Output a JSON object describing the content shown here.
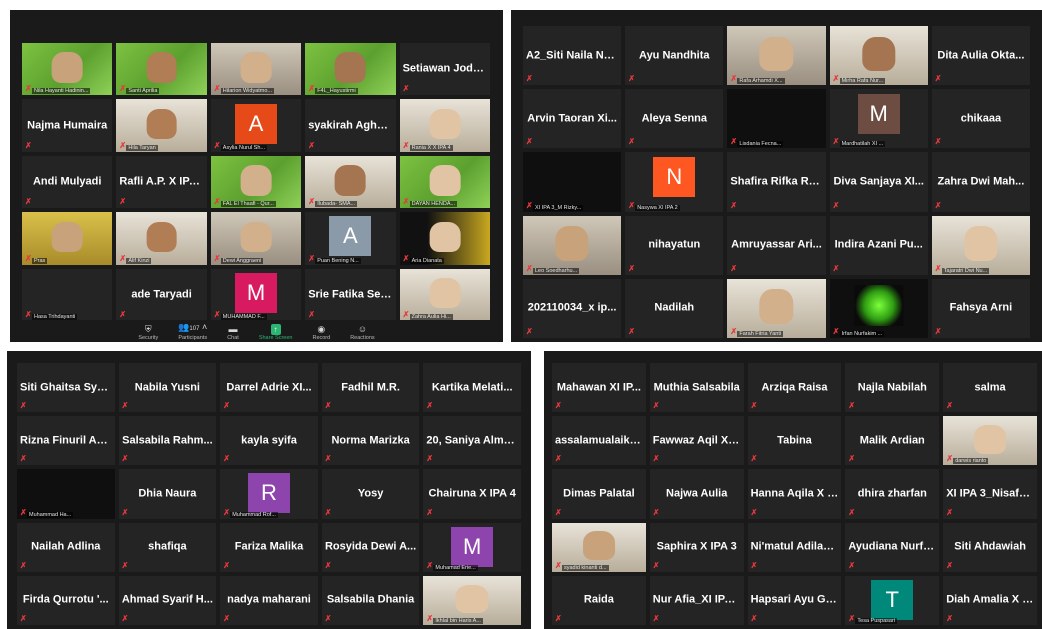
{
  "colors": {
    "mic_muted": "#e8383d",
    "active_speaker": "#c9d94a",
    "share_green": "#2bb673",
    "background": "#1a1a1a",
    "tile": "#242424"
  },
  "panel1": {
    "tiles": [
      {
        "small": "Nila Hayanti Hadinin..."
      },
      {
        "small": "Santi Aprilia"
      },
      {
        "small": "Hilarion Widyatmo..."
      },
      {
        "small": "F4L_Hayustirmi"
      },
      {
        "name": "Setiawan Jody p"
      },
      {
        "name": "Najma Humaira"
      },
      {
        "small": "Hila Taryan"
      },
      {
        "avatar": "A",
        "small": "Asylia Nurul Sh..."
      },
      {
        "name": "syakirah Aghniy..."
      },
      {
        "small": "Rania X X IPA 4"
      },
      {
        "name": "Andi Mulyadi"
      },
      {
        "name": "Rafli A.P. X IPA 4"
      },
      {
        "small": "FAL El Thaafi - Qur..."
      },
      {
        "small": "Ilubada- SMA..."
      },
      {
        "small": "DAYAN HENDA..."
      },
      {
        "small": "Pras"
      },
      {
        "small": "Alif Kinzi"
      },
      {
        "small": "Dewi Anggraeni"
      },
      {
        "avatar": "A",
        "small": "Puan Bening N..."
      },
      {
        "small": "Aria Dianata"
      },
      {
        "small": "Hasa Trihdayanti"
      },
      {
        "name": "ade Taryadi"
      },
      {
        "avatar": "M",
        "small": "MUHAMMAD F..."
      },
      {
        "name": "Srie Fatika Sety..."
      },
      {
        "small": "Zahra Aulia Hi..."
      }
    ],
    "toolbar": {
      "security": "Security",
      "participants": "Participants",
      "participants_count": "107",
      "chat": "Chat",
      "share": "Share Screen",
      "record": "Record",
      "reactions": "Reactions"
    }
  },
  "panel2": {
    "tiles": [
      {
        "name": "A2_Siti Naila Na..."
      },
      {
        "name": "Ayu Nandhita"
      },
      {
        "small": "Rafa Arhamdi X..."
      },
      {
        "small": "Mirha Rafa Nur..."
      },
      {
        "name": "Dita Aulia Okta..."
      },
      {
        "name": "Arvin Taoran Xi..."
      },
      {
        "name": "Aleya Senna"
      },
      {
        "small": "Lisdania Fecna..."
      },
      {
        "avatar": "M",
        "small": "Mardhatilah XI ..."
      },
      {
        "name": "chikaaa"
      },
      {
        "small": "XI IPA 3_M Rizky..."
      },
      {
        "avatar": "N",
        "small": "Nasywa XI IPA 2"
      },
      {
        "name": "Shafira Rifka Ra..."
      },
      {
        "name": "Diva Sanjaya XI..."
      },
      {
        "name": "Zahra Dwi Mah..."
      },
      {
        "small": "Leo Soedharhu..."
      },
      {
        "name": "nihayatun"
      },
      {
        "name": "Amruyassar Ari..."
      },
      {
        "name": "Indira Azani Pu..."
      },
      {
        "small": "Tajaratri Dwi Nu..."
      },
      {
        "name": "202110034_x ip..."
      },
      {
        "name": "Nadilah"
      },
      {
        "small": "Farah Fitria Yanti"
      },
      {
        "small": "Irfan Nurfakim ..."
      },
      {
        "name": "Fahsya Arni"
      }
    ]
  },
  "panel3": {
    "tiles": [
      {
        "name": "Siti Ghaitsa Sya..."
      },
      {
        "name": "Nabila Yusni"
      },
      {
        "name": "Darrel Adrie XI..."
      },
      {
        "name": "Fadhil M.R."
      },
      {
        "name": "Kartika Melati..."
      },
      {
        "name": "Rizna Finuril Au..."
      },
      {
        "name": "Salsabila Rahm..."
      },
      {
        "name": "kayla syifa"
      },
      {
        "name": "Norma Marizka"
      },
      {
        "name": "20, Saniya Alma..."
      },
      {
        "small": "Muhammad Ha..."
      },
      {
        "name": "Dhia Naura"
      },
      {
        "avatar": "R",
        "small": "Muhammad Rof..."
      },
      {
        "name": "Yosy"
      },
      {
        "name": "Chairuna X IPA 4"
      },
      {
        "name": "Nailah Adlina"
      },
      {
        "name": "shafiqa"
      },
      {
        "name": "Fariza Malika"
      },
      {
        "name": "Rosyida Dewi A..."
      },
      {
        "avatar": "M",
        "small": "Muhamad Erie..."
      },
      {
        "name": "Firda Qurrotu '..."
      },
      {
        "name": "Ahmad Syarif H..."
      },
      {
        "name": "nadya maharani"
      },
      {
        "name": "Salsabila Dhania"
      },
      {
        "small": "Ikhlal bin Haris A..."
      }
    ]
  },
  "panel4": {
    "tiles": [
      {
        "name": "Mahawan XI IP..."
      },
      {
        "name": "Muthia Salsabila"
      },
      {
        "name": "Arziqa Raisa"
      },
      {
        "name": "Najla Nabilah"
      },
      {
        "name": "salma"
      },
      {
        "name": "assalamualaikum"
      },
      {
        "name": "Fawwaz Aqil X I..."
      },
      {
        "name": "Tabina"
      },
      {
        "name": "Malik Ardian"
      },
      {
        "small": "darwis rianto"
      },
      {
        "name": "Dimas Palatal"
      },
      {
        "name": "Najwa Aulia"
      },
      {
        "name": "Hanna Aqila X I..."
      },
      {
        "name": "dhira zharfan"
      },
      {
        "name": "XI IPA 3_Nisafat..."
      },
      {
        "small": "syadid kinanti d..."
      },
      {
        "name": "Saphira X IPA 3"
      },
      {
        "name": "Ni'matul Adilah..."
      },
      {
        "name": "Ayudiana Nurfa..."
      },
      {
        "name": "Siti Ahdawiah"
      },
      {
        "name": "Raida"
      },
      {
        "name": "Nur Afia_XI IPA 2"
      },
      {
        "name": "Hapsari Ayu Gal..."
      },
      {
        "avatar": "T",
        "small": "Tesa Puspasari"
      },
      {
        "name": "Diah Amalia X I..."
      }
    ]
  }
}
